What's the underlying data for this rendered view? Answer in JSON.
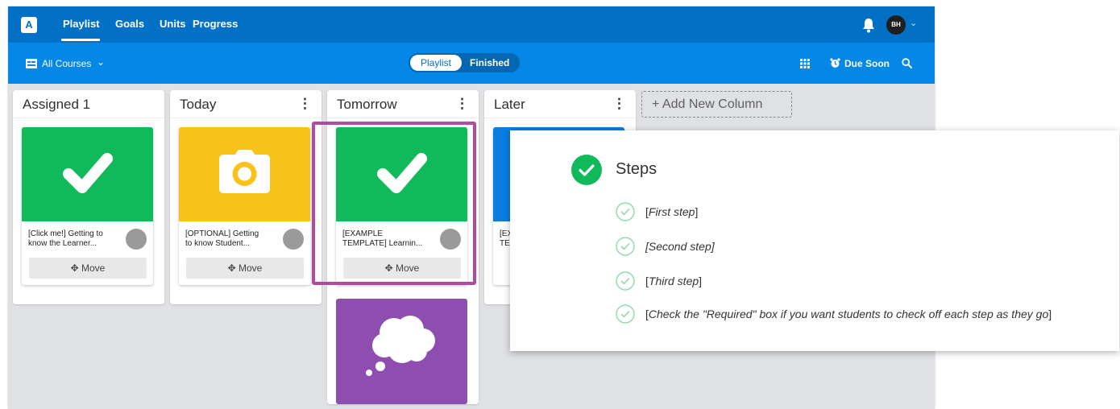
{
  "app": {
    "logo": "A"
  },
  "nav": {
    "links": [
      "Playlist",
      "Goals",
      "Units",
      "Progress"
    ],
    "user_initials": "BH",
    "caret": "⌄"
  },
  "subbar": {
    "courses_label": "All Courses",
    "courses_caret": "⌄",
    "toggle": {
      "active": "Playlist",
      "inactive": "Finished"
    },
    "due_label": "Due Soon"
  },
  "columns": [
    {
      "title": "Assigned 1",
      "has_menu": false,
      "card": {
        "color": "#10b95a",
        "icon": "checkmark-icon",
        "title_lines": [
          "[Click me!] Getting to",
          "know the Learner..."
        ],
        "move_label": "✥ Move"
      }
    },
    {
      "title": "Today",
      "has_menu": true,
      "card": {
        "color": "#f8c21b",
        "icon": "camera-icon",
        "title_lines": [
          "[OPTIONAL] Getting",
          "to know Student..."
        ],
        "move_label": "✥ Move"
      }
    },
    {
      "title": "Tomorrow",
      "has_menu": true,
      "card": {
        "color": "#10b95a",
        "icon": "checkmark-icon",
        "title_lines": [
          "[EXAMPLE",
          "TEMPLATE] Learnin..."
        ],
        "move_label": "✥ Move"
      },
      "card2": {
        "color": "#8d4eb0",
        "icon": "thought-bubble-icon"
      }
    },
    {
      "title": "Later",
      "has_menu": true,
      "card": {
        "color": "#0a7de0",
        "title_lines": [
          "[EX",
          "TE"
        ]
      }
    }
  ],
  "menu_glyph": "⋮",
  "add_column_label": "+ Add New Column",
  "popup": {
    "title": "Steps",
    "steps": [
      {
        "open": "[",
        "text": "First step",
        "close": "]"
      },
      {
        "open": "",
        "text": "[Second step]",
        "close": ""
      },
      {
        "open": "[",
        "text": "Third step",
        "close": "]"
      },
      {
        "open": "[",
        "text": "Check the \"Required\" box if you want students to check off each step as they go",
        "close": "]"
      }
    ]
  },
  "colors": {
    "nav_blue": "#0271c5",
    "subbar_blue": "#0487e6",
    "highlight": "#b04c9f",
    "success_green": "#10b95a"
  }
}
